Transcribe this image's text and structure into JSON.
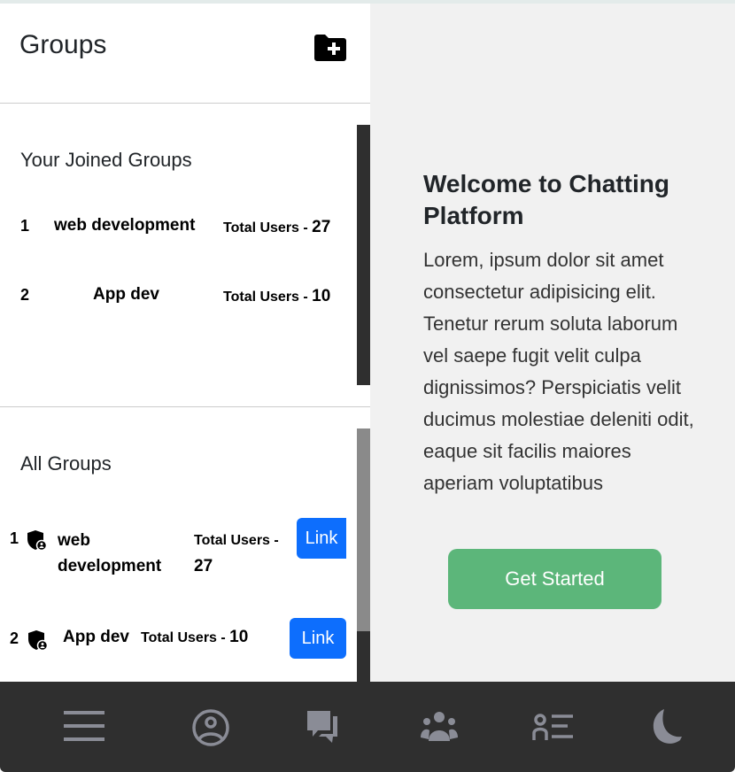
{
  "sidebar": {
    "title": "Groups",
    "add_group_icon": "folder-plus-icon",
    "joined": {
      "heading": "Your Joined Groups",
      "items": [
        {
          "index": "1",
          "name": "web development",
          "total": "Total Users - ",
          "count": "27"
        },
        {
          "index": "2",
          "name": "App dev",
          "total": "Total Users - ",
          "count": "10"
        }
      ]
    },
    "all": {
      "heading": "All Groups",
      "items": [
        {
          "index": "1",
          "name": "web development",
          "total": "Total Users - ",
          "count": "27",
          "button": "Link"
        },
        {
          "index": "2",
          "name": "App dev",
          "total": "Total Users - ",
          "count": "10",
          "button": "Link"
        }
      ]
    }
  },
  "welcome": {
    "title": "Welcome to Chatting Platform",
    "body": "Lorem, ipsum dolor sit amet consectetur adipisicing elit. Tenetur rerum soluta laborum vel saepe fugit velit culpa dignissimos? Perspiciatis velit ducimus molestiae deleniti odit, eaque sit facilis maiores aperiam voluptatibus",
    "button": "Get Started"
  },
  "nav": {
    "icons": [
      "menu-icon",
      "user-circle-icon",
      "chat-icon",
      "group-icon",
      "contacts-icon",
      "moon-icon"
    ]
  },
  "colors": {
    "link": "#0d6efd",
    "get_started": "#5cb67a",
    "nav_bg": "#2f2f2f",
    "nav_icon": "#8a8c96"
  }
}
